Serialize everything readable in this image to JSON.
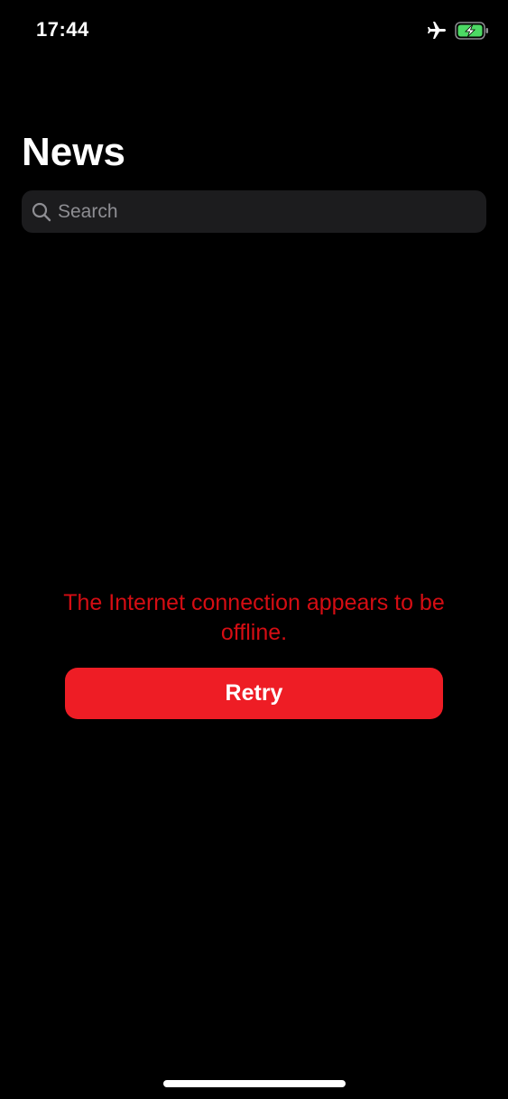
{
  "status_bar": {
    "time": "17:44",
    "icons": [
      "airplane-icon",
      "battery-charging-icon"
    ],
    "battery_color": "#4cd964"
  },
  "header": {
    "title": "News"
  },
  "search": {
    "placeholder": "Search",
    "value": ""
  },
  "error": {
    "message": "The Internet connection appears to be offline.",
    "color": "#d50d13"
  },
  "retry": {
    "label": "Retry",
    "color": "#ee1d25"
  }
}
